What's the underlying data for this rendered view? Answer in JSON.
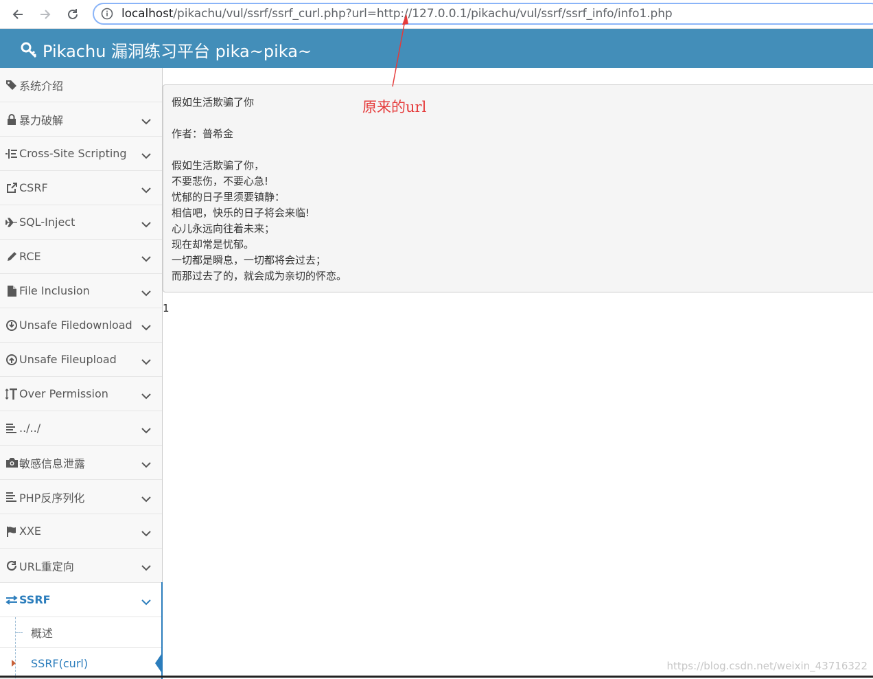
{
  "browser": {
    "url_host": "localhost",
    "url_path": "/pikachu/vul/ssrf/ssrf_curl.php?url=http://127.0.0.1/pikachu/vul/ssrf/ssrf_info/info1.php"
  },
  "header": {
    "title": "Pikachu 漏洞练习平台 pika~pika~"
  },
  "sidebar": {
    "items": [
      {
        "label": "系统介绍",
        "icon": "tags-icon"
      },
      {
        "label": "暴力破解",
        "icon": "lock-icon"
      },
      {
        "label": "Cross-Site Scripting",
        "icon": "indent-icon"
      },
      {
        "label": "CSRF",
        "icon": "share-icon"
      },
      {
        "label": "SQL-Inject",
        "icon": "plane-icon"
      },
      {
        "label": "RCE",
        "icon": "pencil-icon"
      },
      {
        "label": "File Inclusion",
        "icon": "file-icon"
      },
      {
        "label": "Unsafe Filedownload",
        "icon": "download-icon"
      },
      {
        "label": "Unsafe Fileupload",
        "icon": "upload-icon"
      },
      {
        "label": "Over Permission",
        "icon": "text-height-icon"
      },
      {
        "label": "../../",
        "icon": "align-left-icon"
      },
      {
        "label": "敏感信息泄露",
        "icon": "camera-icon"
      },
      {
        "label": "PHP反序列化",
        "icon": "align-left-icon"
      },
      {
        "label": "XXE",
        "icon": "flag-icon"
      },
      {
        "label": "URL重定向",
        "icon": "refresh-icon"
      },
      {
        "label": "SSRF",
        "icon": "exchange-icon"
      }
    ],
    "submenu": [
      {
        "label": "概述"
      },
      {
        "label": "SSRF(curl)"
      }
    ]
  },
  "content": {
    "title": "假如生活欺骗了你",
    "author": "作者：普希金",
    "lines": [
      "假如生活欺骗了你，",
      "不要悲伤，不要心急!",
      "忧郁的日子里须要镇静：",
      "相信吧，快乐的日子将会来临!",
      "心儿永远向往着未来；",
      "现在却常是忧郁。",
      "一切都是瞬息，一切都将会过去；",
      "而那过去了的，就会成为亲切的怀恋。"
    ],
    "result": "1"
  },
  "annotation": {
    "text": "原来的url",
    "color": "#e53a3a"
  },
  "watermark": "https://blog.csdn.net/weixin_43716322",
  "colors": {
    "header": "#438eb9",
    "active": "#2b7dbc"
  }
}
